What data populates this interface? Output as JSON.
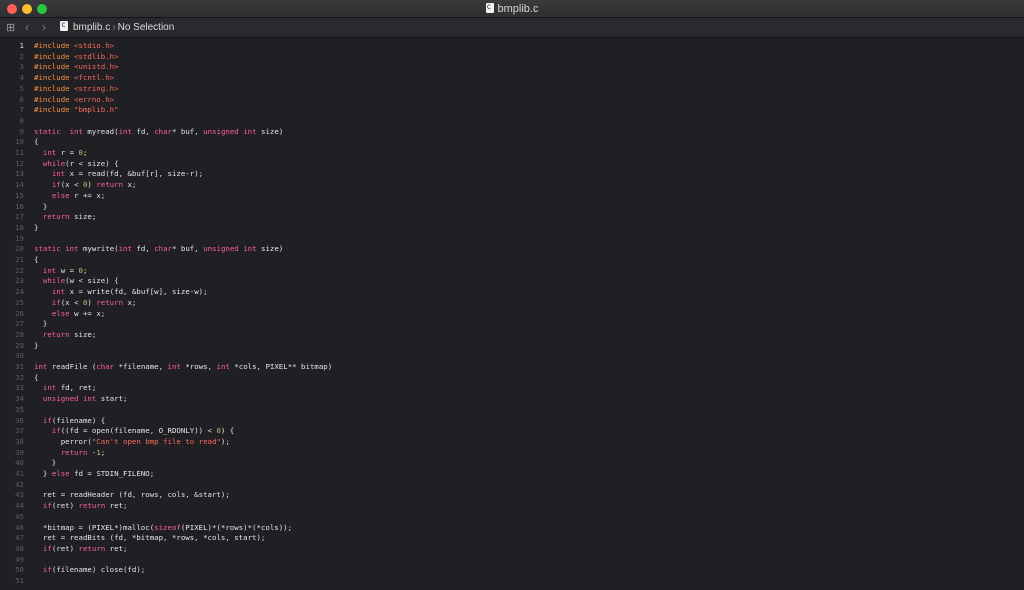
{
  "window": {
    "title": "bmplib.c"
  },
  "jumpbar": {
    "file_name": "bmplib.c",
    "selection": "No Selection"
  },
  "colors": {
    "keyword": "#fc5fa3",
    "preprocessor": "#fd8f3f",
    "string": "#fc6a5d",
    "number": "#d0bf69",
    "plain": "#e6e6e6",
    "line_number": "#5c5c62",
    "background": "#1f1f24"
  },
  "editor": {
    "lines": [
      [
        [
          "pp",
          "#include "
        ],
        [
          "str",
          "<stdio.h>"
        ]
      ],
      [
        [
          "pp",
          "#include "
        ],
        [
          "str",
          "<stdlib.h>"
        ]
      ],
      [
        [
          "pp",
          "#include "
        ],
        [
          "str",
          "<unistd.h>"
        ]
      ],
      [
        [
          "pp",
          "#include "
        ],
        [
          "str",
          "<fcntl.h>"
        ]
      ],
      [
        [
          "pp",
          "#include "
        ],
        [
          "str",
          "<string.h>"
        ]
      ],
      [
        [
          "pp",
          "#include "
        ],
        [
          "str",
          "<errno.h>"
        ]
      ],
      [
        [
          "pp",
          "#include "
        ],
        [
          "str",
          "\"bmplib.h\""
        ]
      ],
      [],
      [
        [
          "kw",
          "static"
        ],
        [
          "",
          "  "
        ],
        [
          "kw",
          "int"
        ],
        [
          "",
          " myread("
        ],
        [
          "kw",
          "int"
        ],
        [
          "",
          " fd, "
        ],
        [
          "kw",
          "char"
        ],
        [
          "",
          "* buf, "
        ],
        [
          "kw",
          "unsigned"
        ],
        [
          "",
          " "
        ],
        [
          "kw",
          "int"
        ],
        [
          "",
          " size)"
        ]
      ],
      [
        [
          "",
          "{"
        ]
      ],
      [
        [
          "",
          "  "
        ],
        [
          "kw",
          "int"
        ],
        [
          "",
          " r = "
        ],
        [
          "num",
          "0"
        ],
        [
          "",
          ";"
        ]
      ],
      [
        [
          "",
          "  "
        ],
        [
          "kw",
          "while"
        ],
        [
          "",
          "(r < size) {"
        ]
      ],
      [
        [
          "",
          "    "
        ],
        [
          "kw",
          "int"
        ],
        [
          "",
          " x = read(fd, &buf[r], size-r);"
        ]
      ],
      [
        [
          "",
          "    "
        ],
        [
          "kw",
          "if"
        ],
        [
          "",
          "(x < "
        ],
        [
          "num",
          "0"
        ],
        [
          "",
          ") "
        ],
        [
          "kw",
          "return"
        ],
        [
          "",
          " x;"
        ]
      ],
      [
        [
          "",
          "    "
        ],
        [
          "kw",
          "else"
        ],
        [
          "",
          " r += x;"
        ]
      ],
      [
        [
          "",
          "  }"
        ]
      ],
      [
        [
          "",
          "  "
        ],
        [
          "kw",
          "return"
        ],
        [
          "",
          " size;"
        ]
      ],
      [
        [
          "",
          "}"
        ]
      ],
      [],
      [
        [
          "kw",
          "static"
        ],
        [
          "",
          " "
        ],
        [
          "kw",
          "int"
        ],
        [
          "",
          " mywrite("
        ],
        [
          "kw",
          "int"
        ],
        [
          "",
          " fd, "
        ],
        [
          "kw",
          "char"
        ],
        [
          "",
          "* buf, "
        ],
        [
          "kw",
          "unsigned"
        ],
        [
          "",
          " "
        ],
        [
          "kw",
          "int"
        ],
        [
          "",
          " size)"
        ]
      ],
      [
        [
          "",
          "{"
        ]
      ],
      [
        [
          "",
          "  "
        ],
        [
          "kw",
          "int"
        ],
        [
          "",
          " w = "
        ],
        [
          "num",
          "0"
        ],
        [
          "",
          ";"
        ]
      ],
      [
        [
          "",
          "  "
        ],
        [
          "kw",
          "while"
        ],
        [
          "",
          "(w < size) {"
        ]
      ],
      [
        [
          "",
          "    "
        ],
        [
          "kw",
          "int"
        ],
        [
          "",
          " x = write(fd, &buf[w], size-w);"
        ]
      ],
      [
        [
          "",
          "    "
        ],
        [
          "kw",
          "if"
        ],
        [
          "",
          "(x < "
        ],
        [
          "num",
          "0"
        ],
        [
          "",
          ") "
        ],
        [
          "kw",
          "return"
        ],
        [
          "",
          " x;"
        ]
      ],
      [
        [
          "",
          "    "
        ],
        [
          "kw",
          "else"
        ],
        [
          "",
          " w += x;"
        ]
      ],
      [
        [
          "",
          "  }"
        ]
      ],
      [
        [
          "",
          "  "
        ],
        [
          "kw",
          "return"
        ],
        [
          "",
          " size;"
        ]
      ],
      [
        [
          "",
          "}"
        ]
      ],
      [],
      [
        [
          "kw",
          "int"
        ],
        [
          "",
          " readFile ("
        ],
        [
          "kw",
          "char"
        ],
        [
          "",
          " *filename, "
        ],
        [
          "kw",
          "int"
        ],
        [
          "",
          " *rows, "
        ],
        [
          "kw",
          "int"
        ],
        [
          "",
          " *cols, PIXEL** bitmap)"
        ]
      ],
      [
        [
          "",
          "{"
        ]
      ],
      [
        [
          "",
          "  "
        ],
        [
          "kw",
          "int"
        ],
        [
          "",
          " fd, ret;"
        ]
      ],
      [
        [
          "",
          "  "
        ],
        [
          "kw",
          "unsigned"
        ],
        [
          "",
          " "
        ],
        [
          "kw",
          "int"
        ],
        [
          "",
          " start;"
        ]
      ],
      [],
      [
        [
          "",
          "  "
        ],
        [
          "kw",
          "if"
        ],
        [
          "",
          "(filename) {"
        ]
      ],
      [
        [
          "",
          "    "
        ],
        [
          "kw",
          "if"
        ],
        [
          "",
          "((fd = open(filename, O_RDONLY)) < "
        ],
        [
          "num",
          "0"
        ],
        [
          "",
          ") {"
        ]
      ],
      [
        [
          "",
          "      perror("
        ],
        [
          "str",
          "\"Can't open bmp file to read\""
        ],
        [
          "",
          ");"
        ]
      ],
      [
        [
          "",
          "      "
        ],
        [
          "kw",
          "return"
        ],
        [
          "",
          " -"
        ],
        [
          "num",
          "1"
        ],
        [
          "",
          ";"
        ]
      ],
      [
        [
          "",
          "    }"
        ]
      ],
      [
        [
          "",
          "  } "
        ],
        [
          "kw",
          "else"
        ],
        [
          "",
          " fd = STDIN_FILENO;"
        ]
      ],
      [],
      [
        [
          "",
          "  ret = readHeader (fd, rows, cols, &start);"
        ]
      ],
      [
        [
          "",
          "  "
        ],
        [
          "kw",
          "if"
        ],
        [
          "",
          "(ret) "
        ],
        [
          "kw",
          "return"
        ],
        [
          "",
          " ret;"
        ]
      ],
      [],
      [
        [
          "",
          "  *bitmap = (PIXEL*)malloc("
        ],
        [
          "kw",
          "sizeof"
        ],
        [
          "",
          "(PIXEL)*(*rows)*(*cols));"
        ]
      ],
      [
        [
          "",
          "  ret = readBits (fd, *bitmap, *rows, *cols, start);"
        ]
      ],
      [
        [
          "",
          "  "
        ],
        [
          "kw",
          "if"
        ],
        [
          "",
          "(ret) "
        ],
        [
          "kw",
          "return"
        ],
        [
          "",
          " ret;"
        ]
      ],
      [],
      [
        [
          "",
          "  "
        ],
        [
          "kw",
          "if"
        ],
        [
          "",
          "(filename) close(fd);"
        ]
      ],
      []
    ],
    "current_line": 1
  }
}
